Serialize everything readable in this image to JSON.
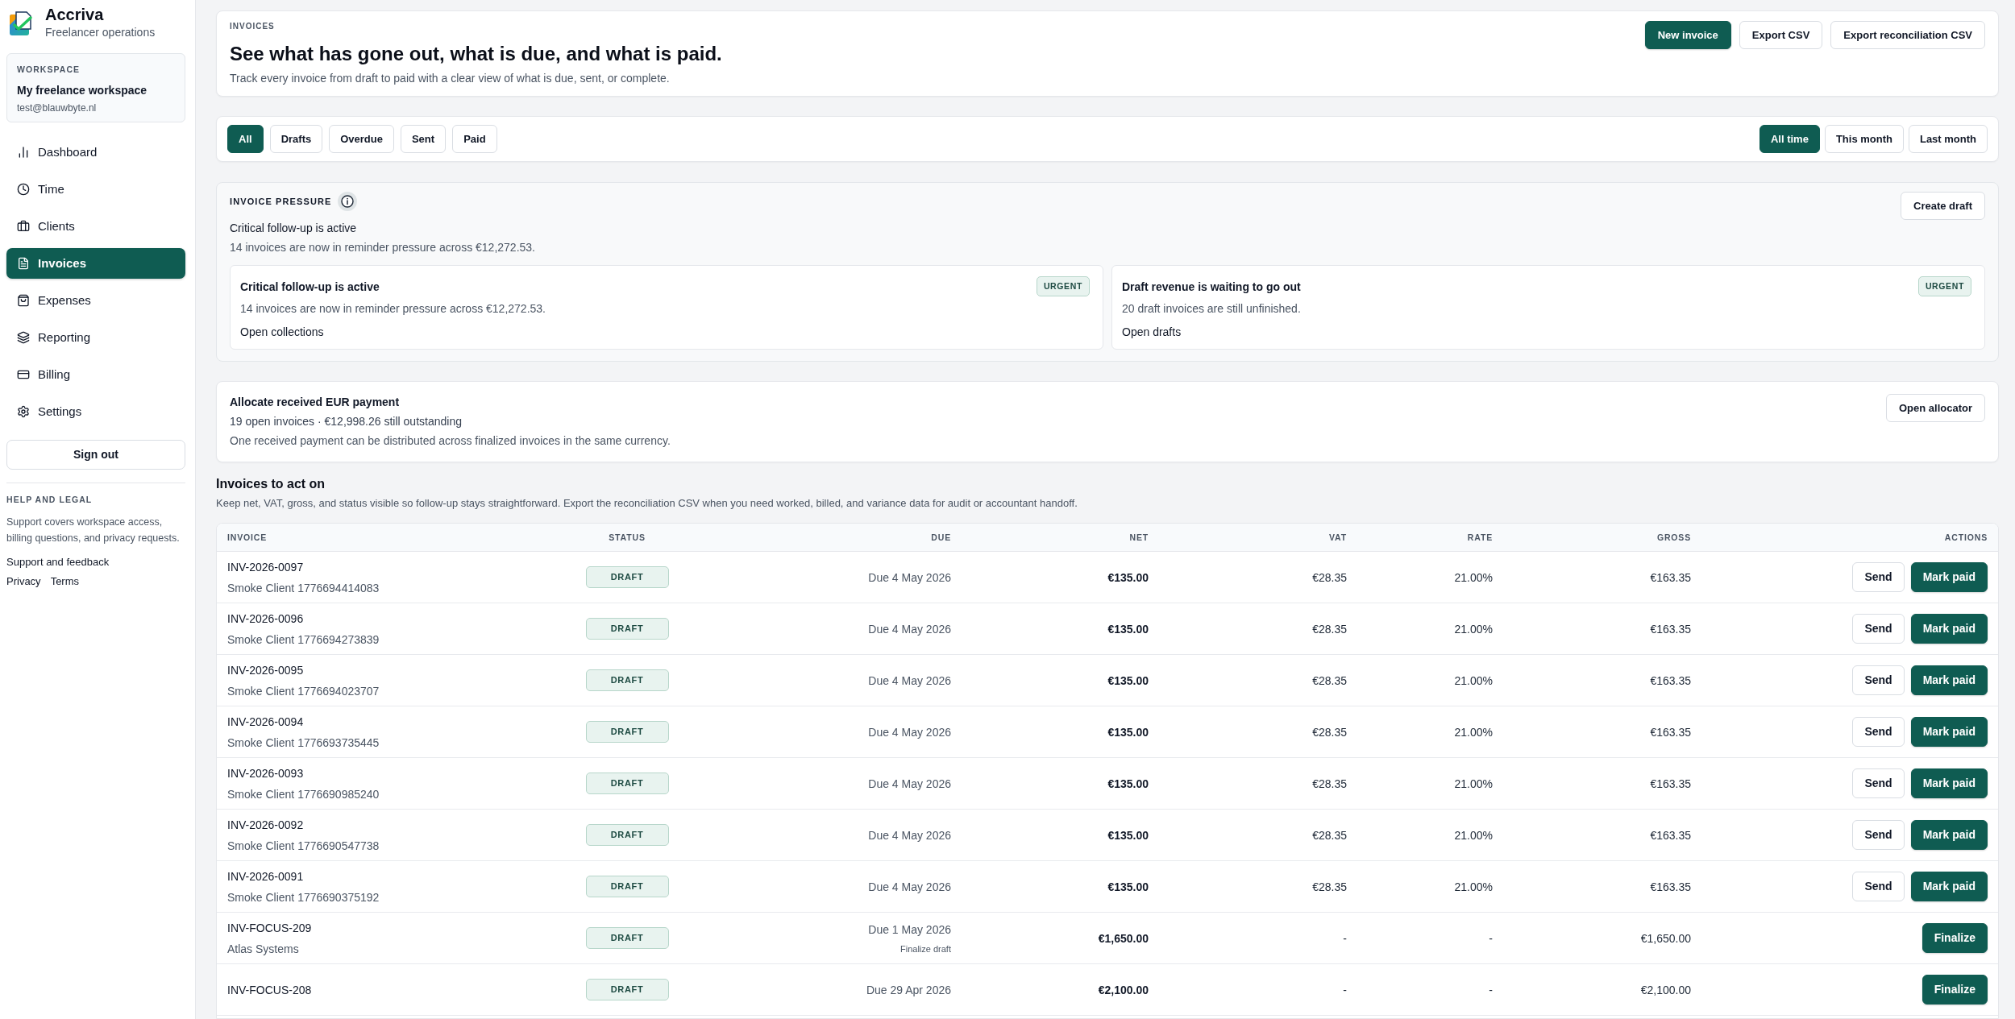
{
  "app": {
    "name": "Accriva",
    "tagline": "Freelancer operations"
  },
  "workspace": {
    "label": "WORKSPACE",
    "name": "My freelance workspace",
    "email": "test@blauwbyte.nl"
  },
  "nav": [
    {
      "label": "Dashboard",
      "selected": false
    },
    {
      "label": "Time",
      "selected": false
    },
    {
      "label": "Clients",
      "selected": false
    },
    {
      "label": "Invoices",
      "selected": true
    },
    {
      "label": "Expenses",
      "selected": false
    },
    {
      "label": "Reporting",
      "selected": false
    },
    {
      "label": "Billing",
      "selected": false
    },
    {
      "label": "Settings",
      "selected": false
    }
  ],
  "sign_out": "Sign out",
  "help": {
    "title": "HELP AND LEGAL",
    "text": "Support covers workspace access, billing questions, and privacy requests.",
    "support_link": "Support and feedback",
    "legal_links": [
      "Privacy",
      "Terms"
    ]
  },
  "header": {
    "eyebrow": "INVOICES",
    "title": "See what has gone out, what is due, and what is paid.",
    "subtitle": "Track every invoice from draft to paid with a clear view of what is due, sent, or complete.",
    "actions": [
      {
        "label": "New invoice",
        "kind": "primary"
      },
      {
        "label": "Export CSV",
        "kind": "secondary"
      },
      {
        "label": "Export reconciliation CSV",
        "kind": "secondary"
      }
    ]
  },
  "filters": {
    "status": [
      {
        "label": "All",
        "selected": true
      },
      {
        "label": "Drafts",
        "selected": false
      },
      {
        "label": "Overdue",
        "selected": false
      },
      {
        "label": "Sent",
        "selected": false
      },
      {
        "label": "Paid",
        "selected": false
      }
    ],
    "period": [
      {
        "label": "All time",
        "selected": true
      },
      {
        "label": "This month",
        "selected": false
      },
      {
        "label": "Last month",
        "selected": false
      }
    ]
  },
  "pressure": {
    "title": "INVOICE PRESSURE",
    "headline": "Critical follow-up is active",
    "summary": "14 invoices are now in reminder pressure across €12,272.53.",
    "action": {
      "label": "Create draft",
      "kind": "secondary"
    },
    "cards": [
      {
        "title": "Critical follow-up is active",
        "badge": "URGENT",
        "text": "14 invoices are now in reminder pressure across €12,272.53.",
        "link": "Open collections"
      },
      {
        "title": "Draft revenue is waiting to go out",
        "badge": "URGENT",
        "text": "20 draft invoices are still unfinished.",
        "link": "Open drafts"
      }
    ]
  },
  "allocation": {
    "title": "Allocate received EUR payment",
    "stats": "19 open invoices · €12,998.26 still outstanding",
    "text": "One received payment can be distributed across finalized invoices in the same currency.",
    "action": {
      "label": "Open allocator",
      "kind": "secondary"
    }
  },
  "table": {
    "title": "Invoices to act on",
    "description": "Keep net, VAT, gross, and status visible so follow-up stays straightforward. Export the reconciliation CSV when you need worked, billed, and variance data for audit or accountant handoff.",
    "columns": [
      "INVOICE",
      "STATUS",
      "DUE",
      "NET",
      "VAT",
      "RATE",
      "GROSS",
      "ACTIONS"
    ],
    "rows": [
      {
        "invoice": "INV-2026-0097",
        "client": "Smoke Client 1776694414083",
        "status": "DRAFT",
        "due": "Due 4 May 2026",
        "net": "€135.00",
        "vat": "€28.35",
        "rate": "21.00%",
        "gross": "€163.35",
        "actions": [
          {
            "label": "Send",
            "kind": "secondary"
          },
          {
            "label": "Mark paid",
            "kind": "primary"
          }
        ]
      },
      {
        "invoice": "INV-2026-0096",
        "client": "Smoke Client 1776694273839",
        "status": "DRAFT",
        "due": "Due 4 May 2026",
        "net": "€135.00",
        "vat": "€28.35",
        "rate": "21.00%",
        "gross": "€163.35",
        "actions": [
          {
            "label": "Send",
            "kind": "secondary"
          },
          {
            "label": "Mark paid",
            "kind": "primary"
          }
        ]
      },
      {
        "invoice": "INV-2026-0095",
        "client": "Smoke Client 1776694023707",
        "status": "DRAFT",
        "due": "Due 4 May 2026",
        "net": "€135.00",
        "vat": "€28.35",
        "rate": "21.00%",
        "gross": "€163.35",
        "actions": [
          {
            "label": "Send",
            "kind": "secondary"
          },
          {
            "label": "Mark paid",
            "kind": "primary"
          }
        ]
      },
      {
        "invoice": "INV-2026-0094",
        "client": "Smoke Client 1776693735445",
        "status": "DRAFT",
        "due": "Due 4 May 2026",
        "net": "€135.00",
        "vat": "€28.35",
        "rate": "21.00%",
        "gross": "€163.35",
        "actions": [
          {
            "label": "Send",
            "kind": "secondary"
          },
          {
            "label": "Mark paid",
            "kind": "primary"
          }
        ]
      },
      {
        "invoice": "INV-2026-0093",
        "client": "Smoke Client 1776690985240",
        "status": "DRAFT",
        "due": "Due 4 May 2026",
        "net": "€135.00",
        "vat": "€28.35",
        "rate": "21.00%",
        "gross": "€163.35",
        "actions": [
          {
            "label": "Send",
            "kind": "secondary"
          },
          {
            "label": "Mark paid",
            "kind": "primary"
          }
        ]
      },
      {
        "invoice": "INV-2026-0092",
        "client": "Smoke Client 1776690547738",
        "status": "DRAFT",
        "due": "Due 4 May 2026",
        "net": "€135.00",
        "vat": "€28.35",
        "rate": "21.00%",
        "gross": "€163.35",
        "actions": [
          {
            "label": "Send",
            "kind": "secondary"
          },
          {
            "label": "Mark paid",
            "kind": "primary"
          }
        ]
      },
      {
        "invoice": "INV-2026-0091",
        "client": "Smoke Client 1776690375192",
        "status": "DRAFT",
        "due": "Due 4 May 2026",
        "net": "€135.00",
        "vat": "€28.35",
        "rate": "21.00%",
        "gross": "€163.35",
        "actions": [
          {
            "label": "Send",
            "kind": "secondary"
          },
          {
            "label": "Mark paid",
            "kind": "primary"
          }
        ]
      },
      {
        "invoice": "INV-FOCUS-209",
        "client": "Atlas Systems",
        "status": "DRAFT",
        "due": "Due 1 May 2026",
        "due_note": "Finalize draft",
        "net": "€1,650.00",
        "vat": "-",
        "rate": "-",
        "gross": "€1,650.00",
        "actions": [
          {
            "label": "Finalize",
            "kind": "primary"
          }
        ]
      },
      {
        "invoice": "INV-FOCUS-208",
        "status": "DRAFT",
        "due": "Due 29 Apr 2026",
        "net": "€2,100.00",
        "vat": "-",
        "rate": "-",
        "gross": "€2,100.00",
        "actions": [
          {
            "label": "Finalize",
            "kind": "primary"
          }
        ]
      }
    ]
  }
}
